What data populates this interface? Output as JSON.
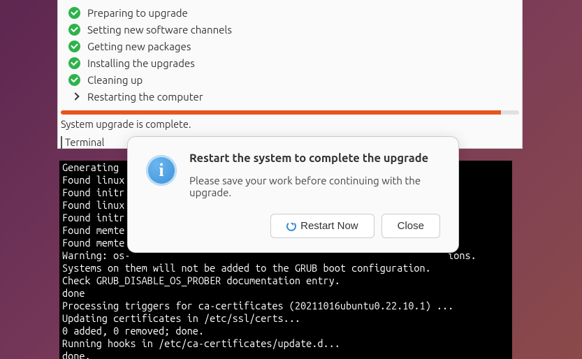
{
  "steps": [
    {
      "label": "Preparing to upgrade",
      "status": "done"
    },
    {
      "label": "Setting new software channels",
      "status": "done"
    },
    {
      "label": "Getting new packages",
      "status": "done"
    },
    {
      "label": "Installing the upgrades",
      "status": "done"
    },
    {
      "label": "Cleaning up",
      "status": "done"
    },
    {
      "label": "Restarting the computer",
      "status": "current"
    }
  ],
  "status_text": "System upgrade is complete.",
  "progress_percent": 96,
  "terminal": {
    "label": "Terminal",
    "lines": [
      "Generating ",
      "Found linux",
      "Found initr",
      "Found linux",
      "Found initr",
      "Found memte",
      "Found memte",
      "Warning: os-                                                        ions.",
      "Systems on them will not be added to the GRUB boot configuration.",
      "Check GRUB_DISABLE_OS_PROBER documentation entry.",
      "done",
      "Processing triggers for ca-certificates (20211016ubuntu0.22.10.1) ...",
      "Updating certificates in /etc/ssl/certs...",
      "0 added, 0 removed; done.",
      "Running hooks in /etc/ca-certificates/update.d...",
      "done."
    ]
  },
  "modal": {
    "title": "Restart the system to complete the upgrade",
    "body": "Please save your work before continuing with the upgrade.",
    "restart_label": "Restart Now",
    "close_label": "Close"
  }
}
